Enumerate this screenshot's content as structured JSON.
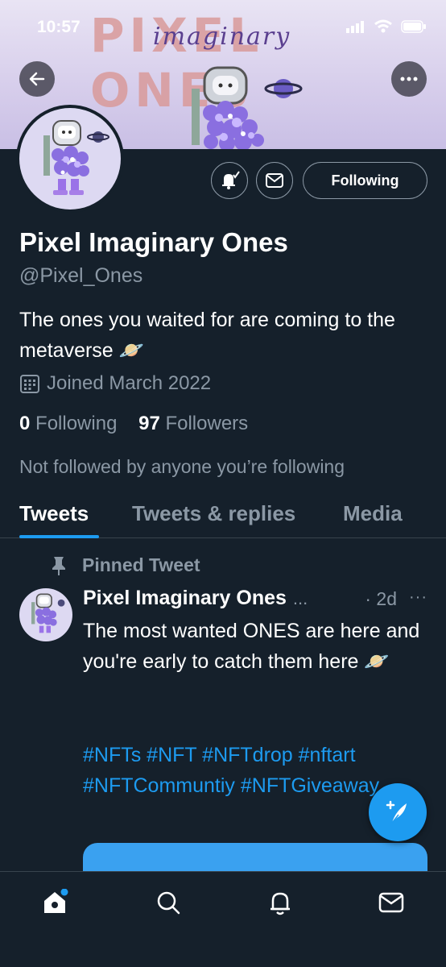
{
  "status_bar": {
    "time": "10:57"
  },
  "banner": {
    "title": "PIXEL ONES",
    "script": "imaginary"
  },
  "profile": {
    "name": "Pixel Imaginary Ones",
    "handle": "@Pixel_Ones",
    "bio": "The ones you waited for are coming to the metaverse 🪐",
    "joined": "Joined March 2022",
    "following_count": "0",
    "following_label": "Following",
    "followers_count": "97",
    "followers_label": "Followers",
    "not_followed": "Not followed by anyone you’re following",
    "follow_button": "Following"
  },
  "tabs": [
    {
      "label": "Tweets",
      "active": true
    },
    {
      "label": "Tweets & replies",
      "active": false
    },
    {
      "label": "Media",
      "active": false
    }
  ],
  "tweet": {
    "pinned_label": "Pinned Tweet",
    "author": "Pixel Imaginary Ones",
    "truncation": "...",
    "time": "· 2d",
    "more": "···",
    "body": "The most wanted ONES are here and you're early to catch them here 🪐",
    "hashtags": "#NFTs #NFT #NFTdrop #nftart #NFTCommuntiy #NFTGiveaway"
  },
  "icons": {
    "back": "arrow-left-icon",
    "more": "more-horizontal-icon",
    "notifications": "bell-check-icon",
    "message": "envelope-icon",
    "calendar": "calendar-icon",
    "pin": "pin-icon",
    "compose": "compose-tweet-icon",
    "nav": [
      "home-icon",
      "search-icon",
      "bell-icon",
      "mail-icon"
    ]
  },
  "colors": {
    "accent": "#1d9bf0",
    "background": "#15202b",
    "muted": "#8b98a5"
  }
}
